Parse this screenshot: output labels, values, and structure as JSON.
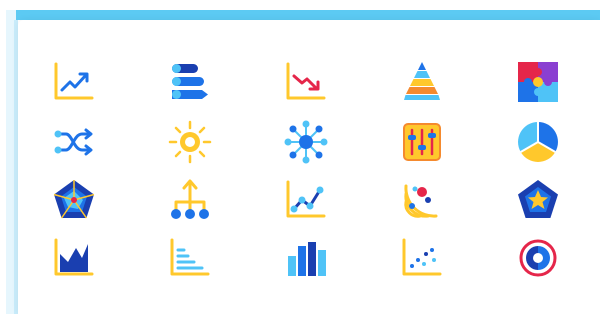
{
  "colors": {
    "frame_accent": "#5ccaf3",
    "yellow": "#ffc82c",
    "blue": "#1e73e8",
    "light_blue": "#4fc3f7",
    "dark_blue": "#1a3fb0",
    "red": "#e5264a",
    "orange": "#f58a2e",
    "purple": "#8a3fd1"
  },
  "icons": [
    [
      "trend-up-chart-icon",
      "horizontal-bars-icon",
      "trend-down-chart-icon",
      "pyramid-chart-icon",
      "puzzle-icon"
    ],
    [
      "shuffle-arrows-icon",
      "sun-burst-icon",
      "network-hub-icon",
      "sliders-panel-icon",
      "pie-chart-icon"
    ],
    [
      "pentagon-radar-icon",
      "hierarchy-tree-icon",
      "line-chart-icon",
      "radar-sweep-icon",
      "pentagon-star-icon"
    ],
    [
      "area-chart-icon",
      "stepped-bars-icon",
      "column-chart-icon",
      "scatter-plot-icon",
      "donut-chart-icon"
    ]
  ]
}
